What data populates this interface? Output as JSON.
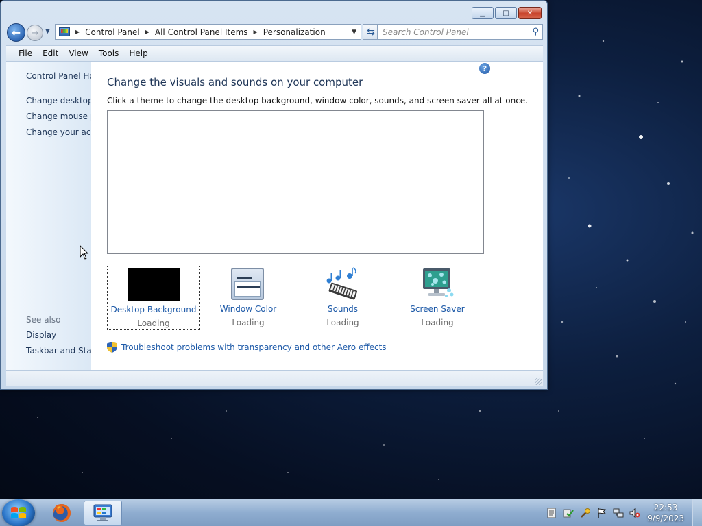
{
  "window": {
    "caption_buttons": {
      "minimize": "▁",
      "maximize": "□",
      "close": "✕"
    }
  },
  "navigation": {
    "breadcrumb": [
      "Control Panel",
      "All Control Panel Items",
      "Personalization"
    ],
    "search_placeholder": "Search Control Panel"
  },
  "menubar": {
    "items": [
      "File",
      "Edit",
      "View",
      "Tools",
      "Help"
    ]
  },
  "left_pane": {
    "links": [
      "Control Panel Home",
      "Change desktop icons",
      "Change mouse pointers",
      "Change your account picture"
    ],
    "see_also_label": "See also",
    "see_also_links": [
      "Display",
      "Taskbar and Start Menu"
    ]
  },
  "content": {
    "title": "Change the visuals and sounds on your computer",
    "description": "Click a theme to change the desktop background, window color, sounds, and screen saver all at once.",
    "tiles": [
      {
        "name": "Desktop Background",
        "status": "Loading",
        "icon": "desktop-background-thumbnail"
      },
      {
        "name": "Window Color",
        "status": "Loading",
        "icon": "window-color-icon"
      },
      {
        "name": "Sounds",
        "status": "Loading",
        "icon": "sounds-icon"
      },
      {
        "name": "Screen Saver",
        "status": "Loading",
        "icon": "screen-saver-icon"
      }
    ],
    "troubleshoot_link": "Troubleshoot problems with transparency and other Aero effects"
  },
  "taskbar": {
    "clock_time": "22:53",
    "clock_date": "9/9/2023",
    "pinned": [
      "firefox",
      "control-panel"
    ]
  },
  "colors": {
    "link": "#1e5aa8",
    "title": "#1e3557",
    "accent": "#2c76c9"
  }
}
